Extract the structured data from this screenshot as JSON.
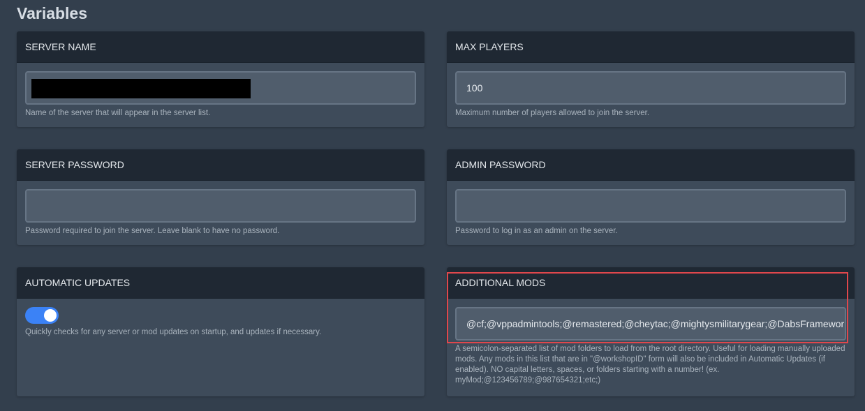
{
  "page": {
    "title": "Variables"
  },
  "cards": {
    "server_name": {
      "label": "SERVER NAME",
      "value": "",
      "help": "Name of the server that will appear in the server list."
    },
    "max_players": {
      "label": "MAX PLAYERS",
      "value": "100",
      "help": "Maximum number of players allowed to join the server."
    },
    "server_password": {
      "label": "SERVER PASSWORD",
      "value": "",
      "help": "Password required to join the server. Leave blank to have no password."
    },
    "admin_password": {
      "label": "ADMIN PASSWORD",
      "value": "",
      "help": "Password to log in as an admin on the server."
    },
    "automatic_updates": {
      "label": "AUTOMATIC UPDATES",
      "enabled": true,
      "help": "Quickly checks for any server or mod updates on startup, and updates if necessary."
    },
    "additional_mods": {
      "label": "ADDITIONAL MODS",
      "value": "@cf;@vppadmintools;@remastered;@cheytac;@mightysmilitarygear;@DabsFramework",
      "help": "A semicolon-separated list of mod folders to load from the root directory. Useful for loading manually uploaded mods. Any mods in this list that are in \"@workshopID\" form will also be included in Automatic Updates (if enabled). NO capital letters, spaces, or folders starting with a number! (ex. myMod;@123456789;@987654321;etc;)"
    }
  },
  "colors": {
    "background": "#333f4d",
    "card": "#3e4b5a",
    "card_header": "#1f2833",
    "input": "#505d6c",
    "toggle_on": "#3b82f6",
    "highlight": "#e0474c"
  }
}
